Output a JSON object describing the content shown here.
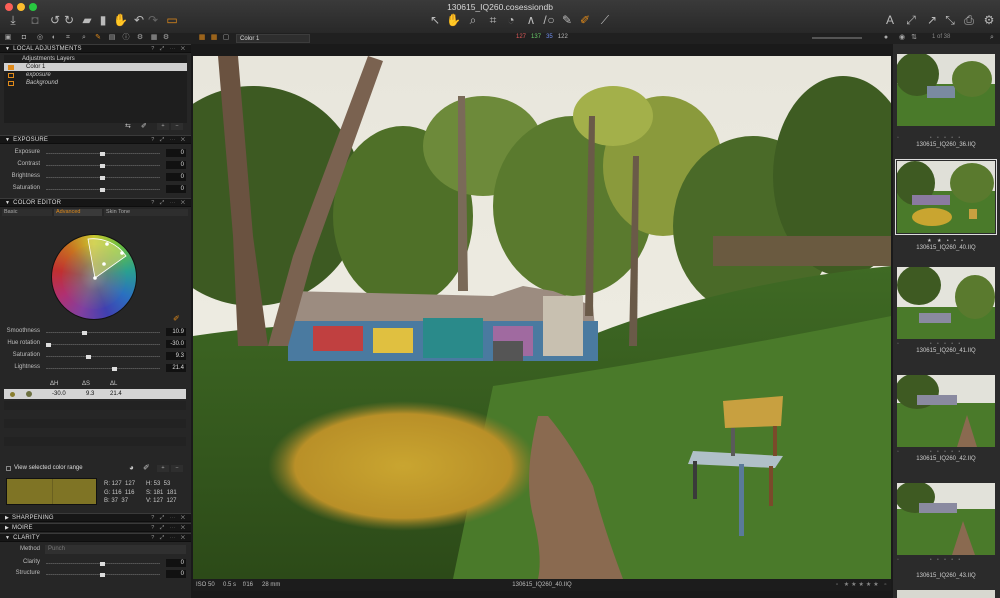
{
  "window": {
    "title": "130615_IQ260.cosessiondb"
  },
  "toolbar": {
    "left_icons": [
      "import-icon",
      "camera-icon",
      "rotate-left-icon",
      "rotate-right-icon",
      "folder-icon",
      "trash-icon",
      "hand-icon",
      "undo-icon",
      "redo-icon",
      "cursor-cycle-icon"
    ],
    "center_icons": [
      "select-icon",
      "pan-icon",
      "zoom-icon",
      "crop-icon",
      "straighten-icon",
      "keystone-icon",
      "spot-icon",
      "circle-icon",
      "draw-mask-icon",
      "brush-icon",
      "eyedropper-icon"
    ],
    "right_icons": [
      "text-icon",
      "expand-icon",
      "arrow-icon",
      "compare-icon",
      "print-icon",
      "settings-icon"
    ]
  },
  "subbar": {
    "color_select": "Color 1",
    "readout": {
      "r": "127",
      "g": "137",
      "b": "35",
      "l": "122"
    },
    "counter": "1 of 38"
  },
  "local_adjustments": {
    "header": "LOCAL ADJUSTMENTS",
    "layers_title": "Adjustments Layers",
    "layers": [
      "Color 1",
      "exposure",
      "Background"
    ]
  },
  "exposure": {
    "header": "EXPOSURE",
    "rows": [
      {
        "label": "Exposure",
        "value": "0"
      },
      {
        "label": "Contrast",
        "value": "0"
      },
      {
        "label": "Brightness",
        "value": "0"
      },
      {
        "label": "Saturation",
        "value": "0"
      }
    ]
  },
  "color_editor": {
    "header": "COLOR EDITOR",
    "tabs": [
      "Basic",
      "Advanced",
      "Skin Tone"
    ],
    "rows": [
      {
        "label": "Smoothness",
        "value": "10.9"
      },
      {
        "label": "Hue rotation",
        "value": "-30.0"
      },
      {
        "label": "Saturation",
        "value": "9.3"
      },
      {
        "label": "Lightness",
        "value": "21.4"
      }
    ],
    "delta_headers": [
      "ΔH",
      "ΔS",
      "ΔL"
    ],
    "delta_values": [
      "-30.0",
      "9.3",
      "21.4"
    ],
    "view_range_label": "View selected color range",
    "swatch_color": "#7f7425",
    "readout": {
      "R": "127  127",
      "G": "116  116",
      "B": "37  37",
      "H": "53  53",
      "S": "181  181",
      "V": "127  127"
    }
  },
  "sections": {
    "sharpening": "SHARPENING",
    "moire": "MOIRE",
    "clarity": "CLARITY"
  },
  "clarity": {
    "method_label": "Method",
    "method_value": "Punch",
    "rows": [
      {
        "label": "Clarity",
        "value": "0"
      },
      {
        "label": "Structure",
        "value": "0"
      }
    ]
  },
  "viewer": {
    "iso": "ISO 50",
    "shutter": "0.5 s",
    "aperture": "f/16",
    "focal": "28 mm",
    "filename": "130615_IQ260_40.IIQ"
  },
  "browser": {
    "thumbs": [
      {
        "label": "130615_IQ260_36.IIQ"
      },
      {
        "label": "130615_IQ260_40.IIQ"
      },
      {
        "label": "130615_IQ260_41.IIQ"
      },
      {
        "label": "130615_IQ260_42.IIQ"
      },
      {
        "label": "130615_IQ260_43.IIQ"
      }
    ]
  },
  "colors": {
    "accent_orange": "#e08a1a",
    "selected_row": "#d0d0d0"
  }
}
